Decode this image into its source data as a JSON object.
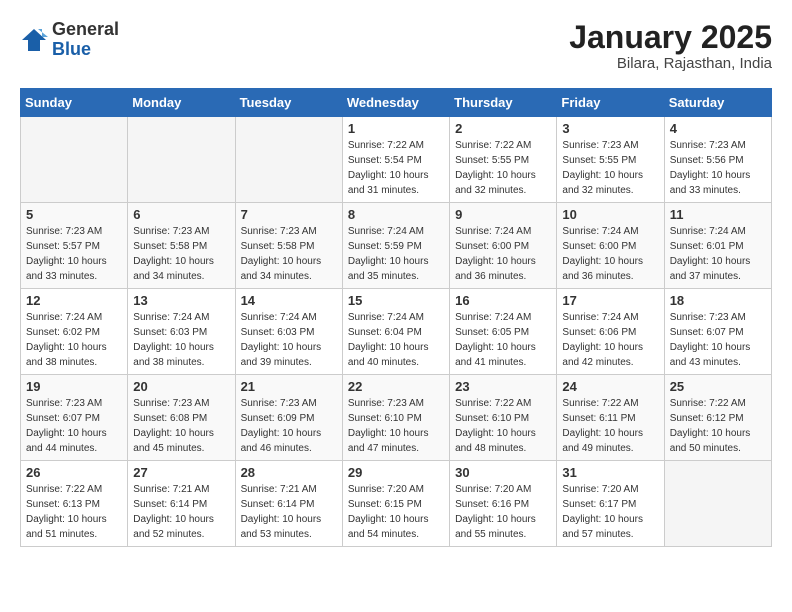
{
  "header": {
    "logo_general": "General",
    "logo_blue": "Blue",
    "month_title": "January 2025",
    "location": "Bilara, Rajasthan, India"
  },
  "weekdays": [
    "Sunday",
    "Monday",
    "Tuesday",
    "Wednesday",
    "Thursday",
    "Friday",
    "Saturday"
  ],
  "weeks": [
    [
      {
        "day": "",
        "sunrise": "",
        "sunset": "",
        "daylight": ""
      },
      {
        "day": "",
        "sunrise": "",
        "sunset": "",
        "daylight": ""
      },
      {
        "day": "",
        "sunrise": "",
        "sunset": "",
        "daylight": ""
      },
      {
        "day": "1",
        "sunrise": "Sunrise: 7:22 AM",
        "sunset": "Sunset: 5:54 PM",
        "daylight": "Daylight: 10 hours and 31 minutes."
      },
      {
        "day": "2",
        "sunrise": "Sunrise: 7:22 AM",
        "sunset": "Sunset: 5:55 PM",
        "daylight": "Daylight: 10 hours and 32 minutes."
      },
      {
        "day": "3",
        "sunrise": "Sunrise: 7:23 AM",
        "sunset": "Sunset: 5:55 PM",
        "daylight": "Daylight: 10 hours and 32 minutes."
      },
      {
        "day": "4",
        "sunrise": "Sunrise: 7:23 AM",
        "sunset": "Sunset: 5:56 PM",
        "daylight": "Daylight: 10 hours and 33 minutes."
      }
    ],
    [
      {
        "day": "5",
        "sunrise": "Sunrise: 7:23 AM",
        "sunset": "Sunset: 5:57 PM",
        "daylight": "Daylight: 10 hours and 33 minutes."
      },
      {
        "day": "6",
        "sunrise": "Sunrise: 7:23 AM",
        "sunset": "Sunset: 5:58 PM",
        "daylight": "Daylight: 10 hours and 34 minutes."
      },
      {
        "day": "7",
        "sunrise": "Sunrise: 7:23 AM",
        "sunset": "Sunset: 5:58 PM",
        "daylight": "Daylight: 10 hours and 34 minutes."
      },
      {
        "day": "8",
        "sunrise": "Sunrise: 7:24 AM",
        "sunset": "Sunset: 5:59 PM",
        "daylight": "Daylight: 10 hours and 35 minutes."
      },
      {
        "day": "9",
        "sunrise": "Sunrise: 7:24 AM",
        "sunset": "Sunset: 6:00 PM",
        "daylight": "Daylight: 10 hours and 36 minutes."
      },
      {
        "day": "10",
        "sunrise": "Sunrise: 7:24 AM",
        "sunset": "Sunset: 6:00 PM",
        "daylight": "Daylight: 10 hours and 36 minutes."
      },
      {
        "day": "11",
        "sunrise": "Sunrise: 7:24 AM",
        "sunset": "Sunset: 6:01 PM",
        "daylight": "Daylight: 10 hours and 37 minutes."
      }
    ],
    [
      {
        "day": "12",
        "sunrise": "Sunrise: 7:24 AM",
        "sunset": "Sunset: 6:02 PM",
        "daylight": "Daylight: 10 hours and 38 minutes."
      },
      {
        "day": "13",
        "sunrise": "Sunrise: 7:24 AM",
        "sunset": "Sunset: 6:03 PM",
        "daylight": "Daylight: 10 hours and 38 minutes."
      },
      {
        "day": "14",
        "sunrise": "Sunrise: 7:24 AM",
        "sunset": "Sunset: 6:03 PM",
        "daylight": "Daylight: 10 hours and 39 minutes."
      },
      {
        "day": "15",
        "sunrise": "Sunrise: 7:24 AM",
        "sunset": "Sunset: 6:04 PM",
        "daylight": "Daylight: 10 hours and 40 minutes."
      },
      {
        "day": "16",
        "sunrise": "Sunrise: 7:24 AM",
        "sunset": "Sunset: 6:05 PM",
        "daylight": "Daylight: 10 hours and 41 minutes."
      },
      {
        "day": "17",
        "sunrise": "Sunrise: 7:24 AM",
        "sunset": "Sunset: 6:06 PM",
        "daylight": "Daylight: 10 hours and 42 minutes."
      },
      {
        "day": "18",
        "sunrise": "Sunrise: 7:23 AM",
        "sunset": "Sunset: 6:07 PM",
        "daylight": "Daylight: 10 hours and 43 minutes."
      }
    ],
    [
      {
        "day": "19",
        "sunrise": "Sunrise: 7:23 AM",
        "sunset": "Sunset: 6:07 PM",
        "daylight": "Daylight: 10 hours and 44 minutes."
      },
      {
        "day": "20",
        "sunrise": "Sunrise: 7:23 AM",
        "sunset": "Sunset: 6:08 PM",
        "daylight": "Daylight: 10 hours and 45 minutes."
      },
      {
        "day": "21",
        "sunrise": "Sunrise: 7:23 AM",
        "sunset": "Sunset: 6:09 PM",
        "daylight": "Daylight: 10 hours and 46 minutes."
      },
      {
        "day": "22",
        "sunrise": "Sunrise: 7:23 AM",
        "sunset": "Sunset: 6:10 PM",
        "daylight": "Daylight: 10 hours and 47 minutes."
      },
      {
        "day": "23",
        "sunrise": "Sunrise: 7:22 AM",
        "sunset": "Sunset: 6:10 PM",
        "daylight": "Daylight: 10 hours and 48 minutes."
      },
      {
        "day": "24",
        "sunrise": "Sunrise: 7:22 AM",
        "sunset": "Sunset: 6:11 PM",
        "daylight": "Daylight: 10 hours and 49 minutes."
      },
      {
        "day": "25",
        "sunrise": "Sunrise: 7:22 AM",
        "sunset": "Sunset: 6:12 PM",
        "daylight": "Daylight: 10 hours and 50 minutes."
      }
    ],
    [
      {
        "day": "26",
        "sunrise": "Sunrise: 7:22 AM",
        "sunset": "Sunset: 6:13 PM",
        "daylight": "Daylight: 10 hours and 51 minutes."
      },
      {
        "day": "27",
        "sunrise": "Sunrise: 7:21 AM",
        "sunset": "Sunset: 6:14 PM",
        "daylight": "Daylight: 10 hours and 52 minutes."
      },
      {
        "day": "28",
        "sunrise": "Sunrise: 7:21 AM",
        "sunset": "Sunset: 6:14 PM",
        "daylight": "Daylight: 10 hours and 53 minutes."
      },
      {
        "day": "29",
        "sunrise": "Sunrise: 7:20 AM",
        "sunset": "Sunset: 6:15 PM",
        "daylight": "Daylight: 10 hours and 54 minutes."
      },
      {
        "day": "30",
        "sunrise": "Sunrise: 7:20 AM",
        "sunset": "Sunset: 6:16 PM",
        "daylight": "Daylight: 10 hours and 55 minutes."
      },
      {
        "day": "31",
        "sunrise": "Sunrise: 7:20 AM",
        "sunset": "Sunset: 6:17 PM",
        "daylight": "Daylight: 10 hours and 57 minutes."
      },
      {
        "day": "",
        "sunrise": "",
        "sunset": "",
        "daylight": ""
      }
    ]
  ]
}
